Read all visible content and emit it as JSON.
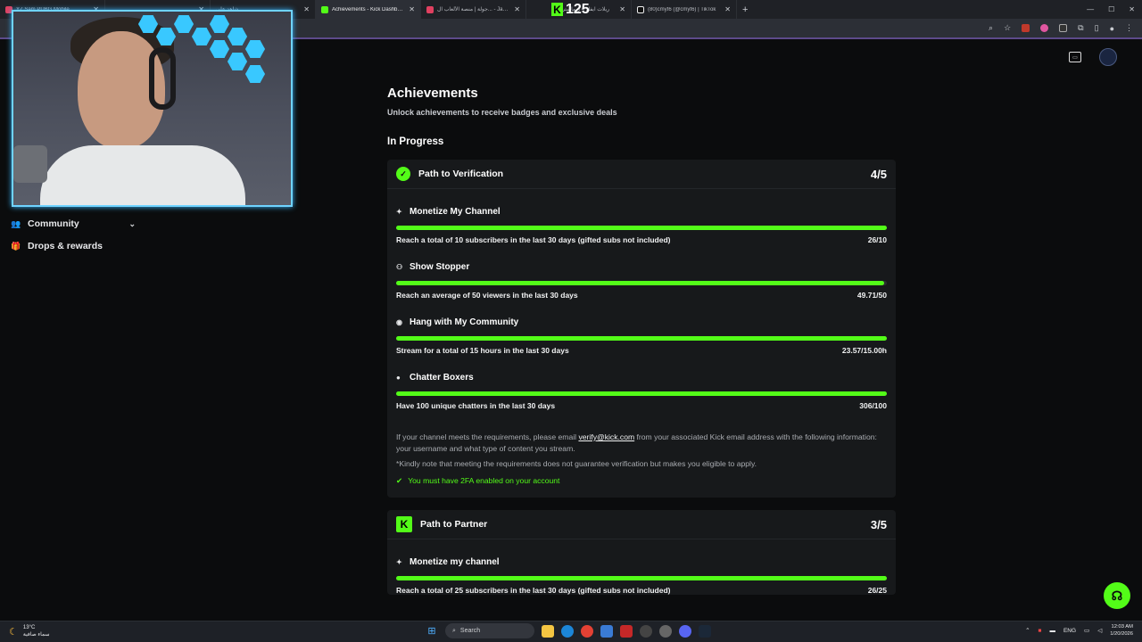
{
  "browser": {
    "tabs": [
      {
        "label": "YZ Sam PUBG Mobile",
        "active": false
      },
      {
        "label": "",
        "active": false
      },
      {
        "label": "",
        "active": false
      },
      {
        "label": "شاهد علي",
        "active": false
      },
      {
        "label": "Achievements - Kick Dashboard",
        "active": true
      },
      {
        "label": "جولة | منصة الألعاب ال... - Jawlah",
        "active": false
      },
      {
        "label": "ريلات ايفل 4 ريماستر",
        "active": false
      },
      {
        "label": "(80)cmyt6 (@cmyt6) | TikTok",
        "active": false
      }
    ],
    "overlay_count": "125"
  },
  "sidebar": {
    "items": [
      {
        "label": "Community",
        "icon": "community-icon",
        "has_chevron": true
      },
      {
        "label": "Drops & rewards",
        "icon": "gift-icon",
        "has_chevron": false
      }
    ]
  },
  "page": {
    "title": "Achievements",
    "subtitle": "Unlock achievements to receive badges and exclusive deals",
    "section": "In Progress"
  },
  "cards": [
    {
      "title": "Path to Verification",
      "progress": "4/5",
      "badge": "verified-icon",
      "requirements": [
        {
          "name": "Monetize My Channel",
          "icon": "sparkle-icon",
          "description": "Reach a total of 10 subscribers in the last 30 days (gifted subs not included)",
          "value": "26/10",
          "fill": 1.0
        },
        {
          "name": "Show Stopper",
          "icon": "viewers-icon",
          "description": "Reach an average of 50 viewers in the last 30 days",
          "value": "49.71/50",
          "fill": 0.994
        },
        {
          "name": "Hang with My Community",
          "icon": "broadcast-icon",
          "description": "Stream for a total of 15 hours in the last 30 days",
          "value": "23.57/15.00h",
          "fill": 1.0
        },
        {
          "name": "Chatter Boxers",
          "icon": "chat-icon",
          "description": "Have 100 unique chatters in the last 30 days",
          "value": "306/100",
          "fill": 1.0
        }
      ],
      "info": {
        "line1_pre": "If your channel meets the requirements, please email ",
        "email": "verify@kick.com",
        "line1_post": " from your associated Kick email address with the following information: your username and what type of content you stream.",
        "note": "*Kindly note that meeting the requirements does not guarantee verification but makes you eligible to apply.",
        "twofa": "You must have 2FA enabled on your account"
      }
    },
    {
      "title": "Path to Partner",
      "progress": "3/5",
      "badge": "kick-logo-icon",
      "requirements": [
        {
          "name": "Monetize my channel",
          "icon": "sparkle-icon",
          "description": "Reach a total of 25 subscribers in the last 30 days (gifted subs not included)",
          "value": "26/25",
          "fill": 1.0
        }
      ]
    }
  ],
  "taskbar": {
    "weather_temp": "13°C",
    "weather_desc": "سماء صافية",
    "search_placeholder": "Search",
    "lang": "ENG",
    "time": "12:03 AM",
    "date": "1/20/2026"
  },
  "colors": {
    "accent": "#53fc18",
    "background": "#0b0c0d",
    "card": "#17191b",
    "cam_border": "#6fd3ff"
  }
}
